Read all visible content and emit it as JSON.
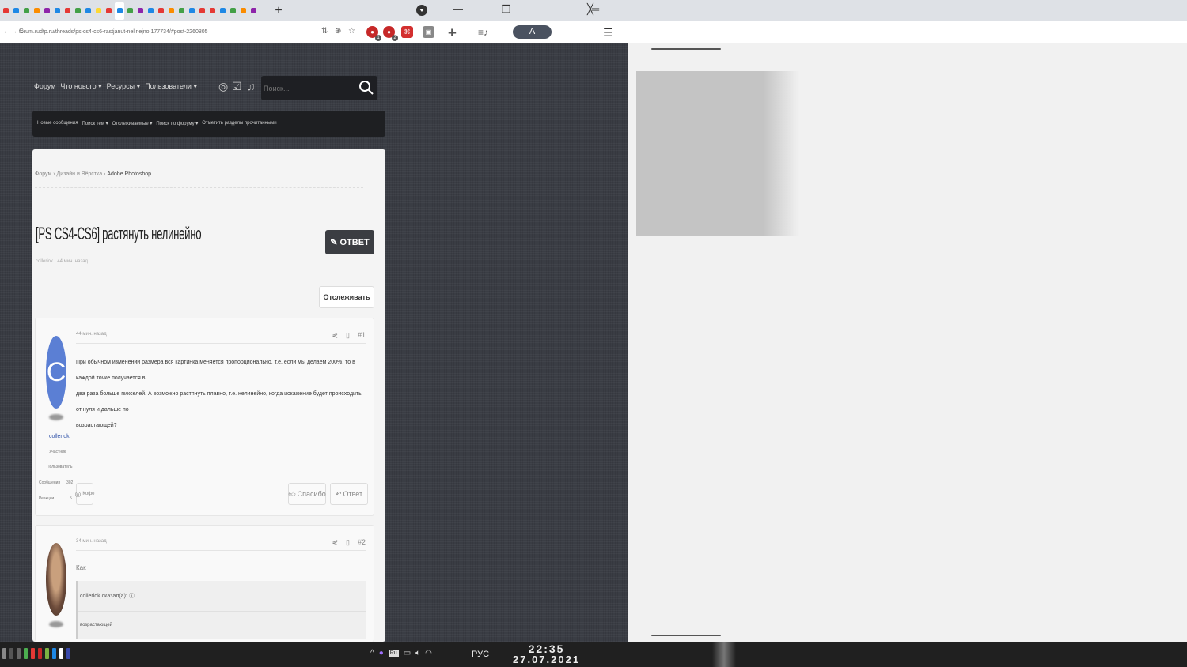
{
  "browser": {
    "tabs": [
      "Ai",
      "E",
      "Ai",
      "B",
      "Ai",
      "G",
      "B",
      "Ai",
      "B",
      "Ai",
      "C",
      "Ai",
      "T",
      "Ai",
      "G",
      "Ai",
      "Ai",
      "Ai",
      "G",
      "Ai",
      "Ai",
      "Ai",
      "Ai",
      "Ai",
      "Ai"
    ],
    "tab_colors": [
      "#e53935",
      "#1e88e5",
      "#43a047",
      "#fb8c00",
      "#8e24aa",
      "#1e88e5",
      "#e53935",
      "#43a047",
      "#1e88e5",
      "#fdd835",
      "#e53935",
      "#1e88e5",
      "#43a047",
      "#8e24aa",
      "#1e88e5",
      "#e53935",
      "#fb8c00",
      "#43a047",
      "#1e88e5",
      "#e53935"
    ],
    "new_tab": "+",
    "url": "forum.rudtp.ru/threads/ps-cs4-cs6-rastjanut-nelinejno.177734/#post-2260805",
    "extension_badges": [
      "1",
      "2"
    ],
    "profile_letter": "A"
  },
  "forum": {
    "nav": [
      "Форум",
      "Что нового",
      "Ресурсы",
      "Пользователи"
    ],
    "search_placeholder": "Поиск...",
    "subnav": [
      "Новые сообщения",
      "Поиск тем",
      "Отслеживаемые",
      "Поиск по форуму",
      "Отметить разделы прочитанными"
    ],
    "breadcrumbs": [
      "Форум",
      "Дизайн и Вёрстка",
      "Adobe Photoshop"
    ],
    "thread_title": "[PS CS4-CS6] растянуть нелинейно",
    "thread_meta": "colleriok · 44 мин. назад",
    "reply_label": "ОТВЕТ",
    "watch_label": "Отслеживать"
  },
  "posts": [
    {
      "date": "44 мин. назад",
      "number": "#1",
      "avatar_letter": "C",
      "username": "colleriok",
      "role": "Участник",
      "sub_role": "Пользователь",
      "stats": [
        [
          "Сообщения",
          "302"
        ],
        [
          "Реакции",
          "5"
        ]
      ],
      "body_small": "При обычном изменении размера вся картинка меняется пропорционально, т.е. если мы делаем 200%, то в каждой точке получается в",
      "body_large": "два раза больше пикселей. А возможно растянуть плавно, т.е. нелинейно, когда искажение будет происходить от нуля и дальше по",
      "body_end": "возрастающей?",
      "coffee": "Кофе",
      "thanks": "Спасибо",
      "reply": "Ответ"
    },
    {
      "date": "34 мин. назад",
      "number": "#2",
      "text": "Как",
      "quote_head": "colleriok сказал(а): ⓘ",
      "quote_body": "возрастающей"
    }
  ],
  "taskbar": {
    "lang": "РУС",
    "time": "22:35",
    "date": "27.07.2021",
    "tray_label": "Ru"
  }
}
